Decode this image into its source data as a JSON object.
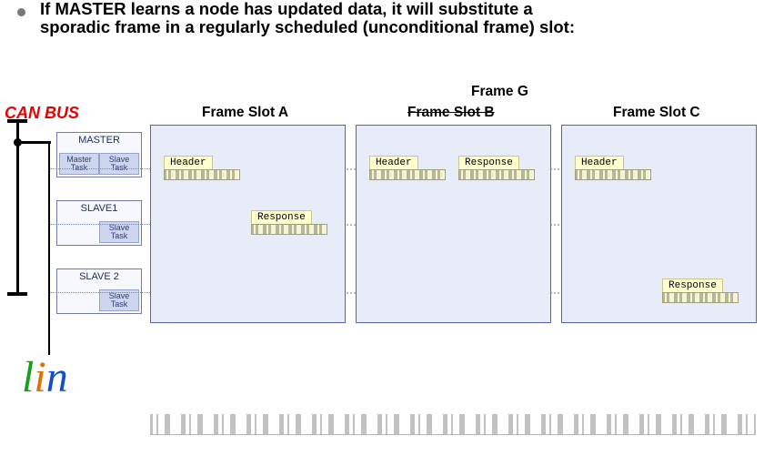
{
  "title_line1": "If MASTER learns a node has updated data, it will substitute a",
  "title_line2": "sporadic frame in a regularly scheduled (unconditional frame) slot:",
  "can_bus_label": "CAN BUS",
  "nodes": {
    "master": {
      "label": "MASTER",
      "task1": "Master Task",
      "task2": "Slave Task"
    },
    "slave1": {
      "label": "SLAVE1",
      "task": "Slave Task"
    },
    "slave2": {
      "label": "SLAVE 2",
      "task": "Slave Task"
    }
  },
  "slot_labels": {
    "a": "Frame Slot A",
    "b": "Frame Slot B",
    "c": "Frame Slot C",
    "g": "Frame G"
  },
  "tags": {
    "header": "Header",
    "response": "Response"
  },
  "lin_logo": {
    "l": "l",
    "i": "i",
    "n": "n"
  }
}
